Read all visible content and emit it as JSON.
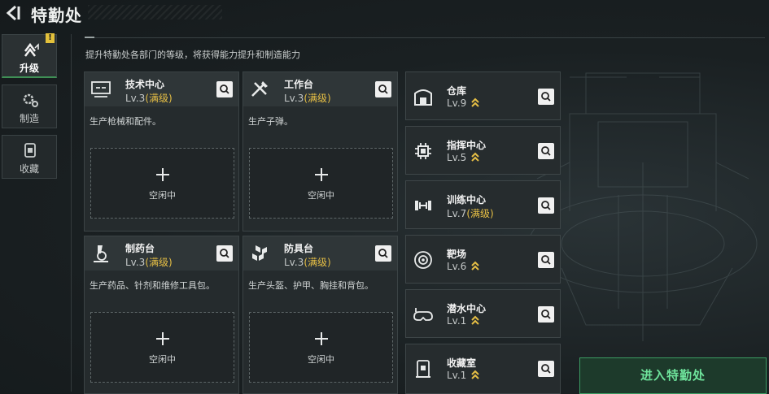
{
  "header": {
    "title": "特勤处"
  },
  "tabs": [
    {
      "label": "升级",
      "icon": "upgrade-arrows-icon",
      "active": true,
      "badge": "!"
    },
    {
      "label": "制造",
      "icon": "gears-icon",
      "active": false
    },
    {
      "label": "收藏",
      "icon": "collection-case-icon",
      "active": false
    }
  ],
  "subtitle": "提升特勤处各部门的等级，将获得能力提升和制造能力",
  "workshops": [
    {
      "name": "技术中心",
      "level": "Lv.3",
      "status": "(满级)",
      "desc": "生产枪械和配件。",
      "slot_plus": "+",
      "slot_label": "空闲中",
      "icon": "tech-center-icon"
    },
    {
      "name": "工作台",
      "level": "Lv.3",
      "status": "(满级)",
      "desc": "生产子弹。",
      "slot_plus": "+",
      "slot_label": "空闲中",
      "icon": "tools-icon"
    },
    {
      "name": "制药台",
      "level": "Lv.3",
      "status": "(满级)",
      "desc": "生产药品、针剂和维修工具包。",
      "slot_plus": "+",
      "slot_label": "空闲中",
      "icon": "microscope-icon"
    },
    {
      "name": "防具台",
      "level": "Lv.3",
      "status": "(满级)",
      "desc": "生产头盔、护甲、胸挂和背包。",
      "slot_plus": "+",
      "slot_label": "空闲中",
      "icon": "armor-blocks-icon"
    }
  ],
  "facilities": [
    {
      "name": "仓库",
      "level": "Lv.9",
      "status": "",
      "upgradable": true,
      "icon": "warehouse-icon"
    },
    {
      "name": "指挥中心",
      "level": "Lv.5",
      "status": "",
      "upgradable": true,
      "icon": "chip-icon"
    },
    {
      "name": "训练中心",
      "level": "Lv.7",
      "status": "(满级)",
      "upgradable": false,
      "icon": "dumbbell-icon"
    },
    {
      "name": "靶场",
      "level": "Lv.6",
      "status": "",
      "upgradable": true,
      "icon": "target-icon"
    },
    {
      "name": "潜水中心",
      "level": "Lv.1",
      "status": "",
      "upgradable": true,
      "icon": "diving-goggles-icon"
    },
    {
      "name": "收藏室",
      "level": "Lv.1",
      "status": "",
      "upgradable": true,
      "icon": "collection-room-icon"
    }
  ],
  "enter_button": {
    "label": "进入特勤处"
  },
  "colors": {
    "accent_green": "#6ee39b",
    "max_level_gold": "#e6bf45",
    "badge_yellow": "#e3c13b"
  }
}
